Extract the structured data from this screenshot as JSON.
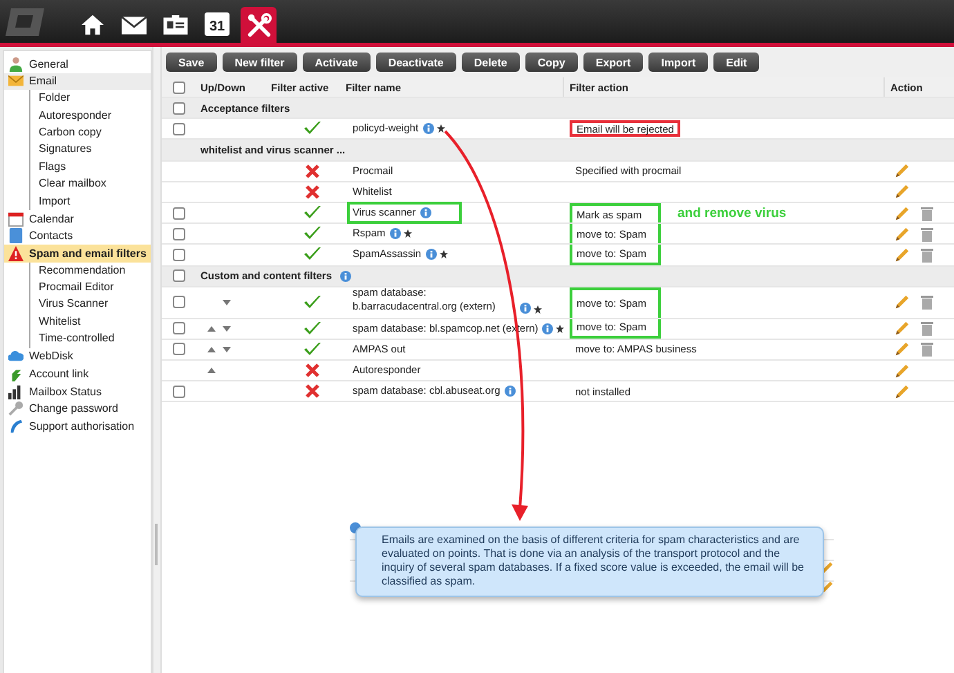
{
  "nav": {
    "icons": [
      {
        "kind": "home",
        "selected": false
      },
      {
        "kind": "mail",
        "selected": false
      },
      {
        "kind": "contacts",
        "selected": false
      },
      {
        "kind": "calendar",
        "label": "31",
        "selected": false
      },
      {
        "kind": "tools",
        "selected": true
      }
    ]
  },
  "sidebar": {
    "items": [
      {
        "label": "General",
        "kind": "person",
        "selected": false
      },
      {
        "label": "Email",
        "kind": "mail",
        "selected": false,
        "highlight": true,
        "children": [
          {
            "label": "Folder"
          },
          {
            "label": "Autoresponder"
          },
          {
            "label": "Carbon copy"
          },
          {
            "label": "Signatures"
          },
          {
            "label": "Flags"
          },
          {
            "label": "Clear mailbox"
          },
          {
            "label": "Import"
          }
        ]
      },
      {
        "label": "Calendar",
        "kind": "calendar",
        "selected": false
      },
      {
        "label": "Contacts",
        "kind": "contacts",
        "selected": false
      },
      {
        "label": "Spam and email filters",
        "kind": "warning",
        "selected": true,
        "children": [
          {
            "label": "Recommendation"
          },
          {
            "label": "Procmail Editor"
          },
          {
            "label": "Virus Scanner"
          },
          {
            "label": "Whitelist"
          },
          {
            "label": "Time-controlled"
          }
        ]
      },
      {
        "label": "WebDisk",
        "kind": "cloud",
        "selected": false
      },
      {
        "label": "Account link",
        "kind": "link",
        "selected": false
      },
      {
        "label": "Mailbox Status",
        "kind": "bars",
        "selected": false
      },
      {
        "label": "Change password",
        "kind": "key",
        "selected": false
      },
      {
        "label": "Support authorisation",
        "kind": "phone",
        "selected": false
      }
    ]
  },
  "toolbar": {
    "buttons": [
      "Save",
      "New filter",
      "Activate",
      "Deactivate",
      "Delete",
      "Copy",
      "Export",
      "Import",
      "Edit"
    ]
  },
  "table": {
    "select_all": {
      "checked": false
    },
    "columns": [
      "Up/Down",
      "Filter active",
      "Filter name",
      "Filter action",
      "Action"
    ],
    "rows": [
      {
        "kind": "group",
        "checked": false,
        "label": "Acceptance filters"
      },
      {
        "kind": "filter",
        "checked": false,
        "active": true,
        "name": "policyd-weight",
        "info": true,
        "star": true,
        "action": "Email will be rejected",
        "action_box": {
          "color": "#e8303a"
        }
      },
      {
        "kind": "group",
        "label": "whitelist and virus scanner ..."
      },
      {
        "kind": "filter",
        "active": false,
        "name": "Procmail",
        "action": "Specified with procmail",
        "edit": true
      },
      {
        "kind": "filter",
        "active": false,
        "name": "Whitelist",
        "edit": true
      },
      {
        "kind": "filter",
        "checked": false,
        "active": true,
        "name": "Virus scanner",
        "info": true,
        "name_box": {
          "color": "#3ccf3c"
        },
        "action": "Mark as spam",
        "action_box": {
          "color": "#3ccf3c"
        },
        "note": "and remove virus",
        "edit": true,
        "delete": true
      },
      {
        "kind": "filter",
        "checked": false,
        "active": true,
        "name": "Rspam",
        "info": true,
        "star": true,
        "action": "move to: Spam",
        "action_box": {
          "color": "#3ccf3c"
        },
        "edit": true,
        "delete": true
      },
      {
        "kind": "filter",
        "checked": false,
        "active": true,
        "name": "SpamAssassin",
        "info": true,
        "star": true,
        "action": "move to: Spam",
        "action_box": {
          "color": "#3ccf3c"
        },
        "edit": true,
        "delete": true
      },
      {
        "kind": "group",
        "checked": false,
        "label": "Custom and content filters",
        "info": true
      },
      {
        "kind": "filter",
        "checked": false,
        "down": true,
        "active": true,
        "name": "spam database: b.barracudacentral.org (extern)",
        "info": true,
        "star": true,
        "action": "move to: Spam",
        "action_box": {
          "color": "#3ccf3c"
        },
        "edit": true,
        "delete": true
      },
      {
        "kind": "filter",
        "checked": false,
        "up": true,
        "down": true,
        "active": true,
        "name": "spam database: bl.spamcop.net (extern)",
        "info": true,
        "star": true,
        "action": "move to: Spam",
        "action_box": {
          "color": "#3ccf3c"
        },
        "edit": true,
        "delete": true
      },
      {
        "kind": "filter",
        "checked": false,
        "up": true,
        "down": true,
        "active": true,
        "name": "AMPAS out",
        "action": "move to: AMPAS business",
        "edit": true,
        "delete": true
      },
      {
        "kind": "filter",
        "up": true,
        "active": false,
        "name": "Autoresponder",
        "edit": true
      },
      {
        "kind": "filter",
        "checked": false,
        "active": false,
        "name": "spam database: cbl.abuseat.org",
        "info": true,
        "action": "not installed",
        "edit": true
      }
    ]
  },
  "tooltip": {
    "text": "Emails are examined on the basis of different criteria for spam characteristics and are evaluated on points. That is done via an analysis of the transport protocol and the inquiry of several spam databases. If a fixed score value is exceeded, the email will be classified as spam."
  }
}
